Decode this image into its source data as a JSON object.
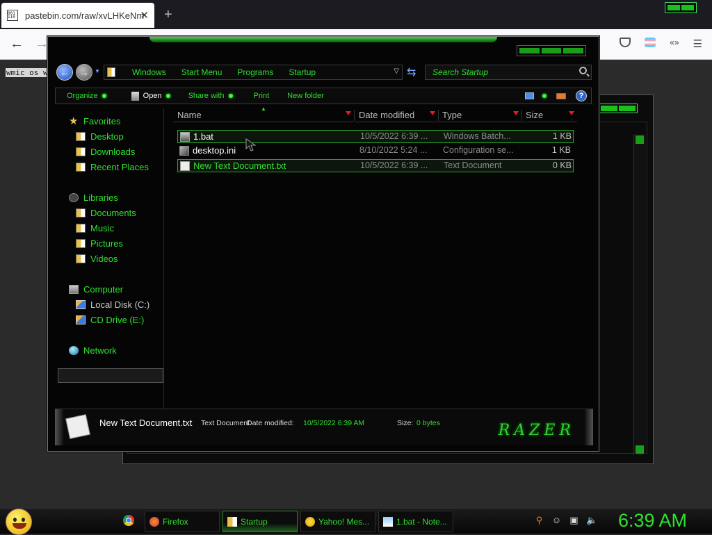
{
  "browser": {
    "tab_title": "pastebin.com/raw/xvLHKeNm",
    "favicon_text": "001 110",
    "page_text": "wmic os w"
  },
  "explorer": {
    "breadcrumbs": [
      "Windows",
      "Start Menu",
      "Programs",
      "Startup"
    ],
    "search_placeholder": "Search Startup",
    "toolbar": {
      "organize": "Organize",
      "open": "Open",
      "share_with": "Share with",
      "print": "Print",
      "new_folder": "New folder",
      "help": "?"
    },
    "nav": {
      "favorites": "Favorites",
      "desktop": "Desktop",
      "downloads": "Downloads",
      "recent_places": "Recent Places",
      "libraries": "Libraries",
      "documents": "Documents",
      "music": "Music",
      "pictures": "Pictures",
      "videos": "Videos",
      "computer": "Computer",
      "local_disk": "Local Disk (C:)",
      "cd_drive": "CD Drive (E:)",
      "network": "Network"
    },
    "columns": {
      "name": "Name",
      "date": "Date modified",
      "type": "Type",
      "size": "Size"
    },
    "files": [
      {
        "name": "1.bat",
        "date": "10/5/2022 6:39 ...",
        "type": "Windows Batch...",
        "size": "1 KB"
      },
      {
        "name": "desktop.ini",
        "date": "8/10/2022 5:24 ...",
        "type": "Configuration se...",
        "size": "1 KB"
      },
      {
        "name": "New Text Document.txt",
        "date": "10/5/2022 6:39 ...",
        "type": "Text Document",
        "size": "0 KB"
      }
    ],
    "details": {
      "name": "New Text Document.txt",
      "type": "Text Document",
      "modified_label": "Date modified:",
      "modified_value": "10/5/2022 6:39 AM",
      "size_label": "Size:",
      "size_value": "0 bytes",
      "brand": "RAZER"
    }
  },
  "taskbar": {
    "items": [
      {
        "label": "Firefox"
      },
      {
        "label": "Startup"
      },
      {
        "label": "Yahoo! Mes..."
      },
      {
        "label": "1.bat - Note..."
      }
    ],
    "clock": "6:39 AM"
  },
  "colors": {
    "accent_green": "#2fe02f",
    "background": "#050505"
  }
}
